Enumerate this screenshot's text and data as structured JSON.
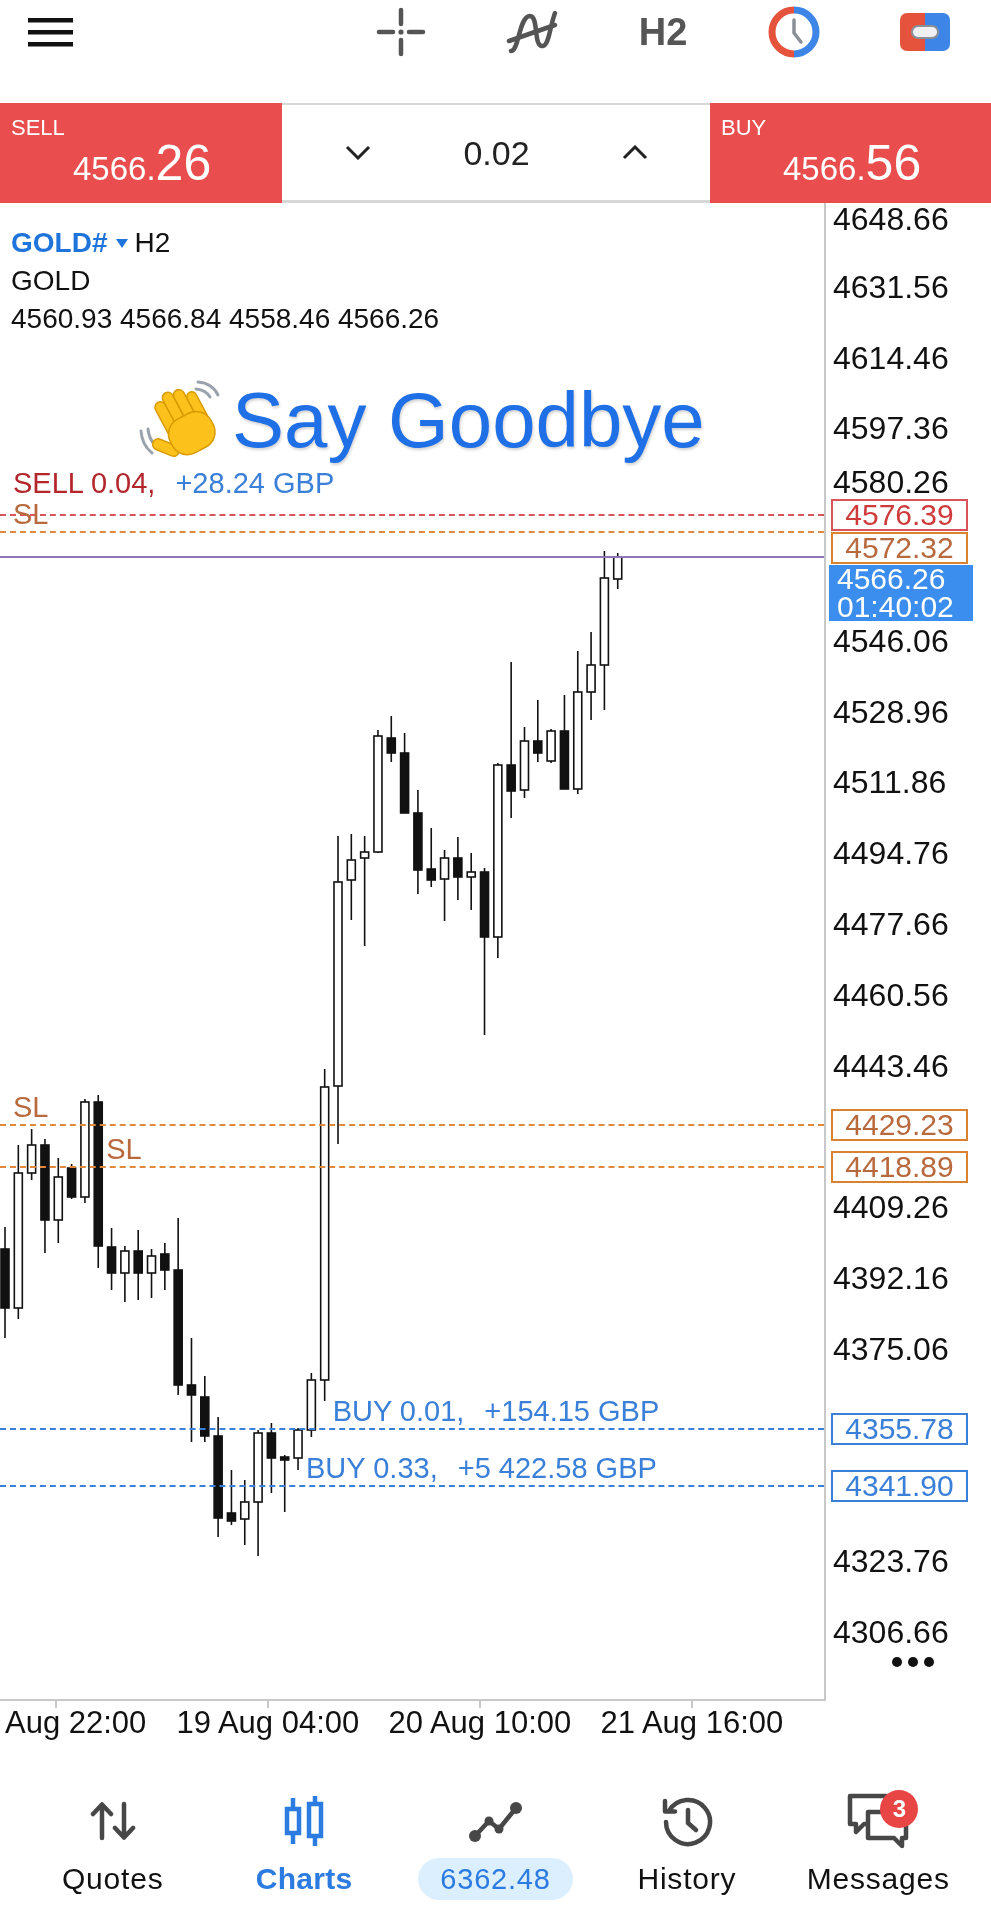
{
  "top_bar": {
    "timeframe": "H2"
  },
  "trade_panel": {
    "sell": {
      "label": "SELL",
      "price": "4566.",
      "pips": "26"
    },
    "volume": "0.02",
    "buy": {
      "label": "BUY",
      "price": "4566.",
      "pips": "56"
    }
  },
  "chart": {
    "symbol": "GOLD#",
    "timeframe": "H2",
    "description": "GOLD",
    "ohlc": "4560.93 4566.84 4558.46 4566.26",
    "caption": "Say Goodbye",
    "order_lines": [
      {
        "kind": "sell",
        "label": "SELL 0.04,",
        "profit": "+28.24 GBP",
        "price": "4576.39"
      },
      {
        "kind": "stop_loss",
        "label": "SL",
        "price": "4572.32"
      },
      {
        "kind": "stop_loss",
        "label": "SL",
        "price": "4429.23"
      },
      {
        "kind": "stop_loss",
        "label": "SL",
        "price": "4418.89"
      },
      {
        "kind": "buy",
        "label": "BUY 0.01,",
        "profit": "+154.15 GBP",
        "price": "4355.78"
      },
      {
        "kind": "buy",
        "label": "BUY 0.33,",
        "profit": "+5 422.58 GBP",
        "price": "4341.90"
      }
    ],
    "current_price": {
      "price": "4566.26",
      "countdown": "01:40:02"
    },
    "price_axis": [
      "4648.66",
      "4631.56",
      "4614.46",
      "4597.36",
      "4580.26",
      "4546.06",
      "4528.96",
      "4511.86",
      "4494.76",
      "4477.66",
      "4460.56",
      "4443.46",
      "4409.26",
      "4392.16",
      "4375.06",
      "4323.76",
      "4306.66"
    ],
    "time_axis": [
      "Aug 22:00",
      "19 Aug 04:00",
      "20 Aug 10:00",
      "21 Aug 16:00"
    ]
  },
  "bottom_nav": [
    {
      "kind": "tab",
      "label": "Quotes",
      "selected": false
    },
    {
      "kind": "tab",
      "label": "Charts",
      "selected": true
    },
    {
      "kind": "balance",
      "label": "6362.48",
      "selected": false
    },
    {
      "kind": "tab",
      "label": "History",
      "selected": false
    },
    {
      "kind": "tab",
      "label": "Messages",
      "selected": false,
      "badge": "3"
    }
  ]
}
